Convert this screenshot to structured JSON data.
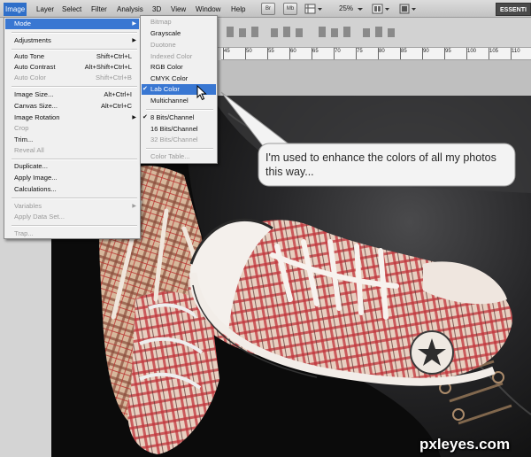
{
  "menubar": {
    "items": [
      "Image",
      "Layer",
      "Select",
      "Filter",
      "Analysis",
      "3D",
      "View",
      "Window",
      "Help"
    ],
    "tool_icons": [
      "Br",
      "Mb"
    ],
    "zoom": "25%",
    "workspace": "ESSENTI"
  },
  "ruler": {
    "numbers": [
      "45",
      "50",
      "55",
      "60",
      "65",
      "70",
      "75",
      "80",
      "85",
      "90",
      "95",
      "100",
      "105",
      "110"
    ]
  },
  "image_menu": {
    "items": [
      {
        "label": "Mode",
        "shortcut": "",
        "submenu": true,
        "state": "highlighted"
      },
      {
        "label": "Adjustments",
        "shortcut": "",
        "submenu": true,
        "state": "enabled"
      },
      {
        "label": "Auto Tone",
        "shortcut": "Shift+Ctrl+L",
        "submenu": false,
        "state": "enabled"
      },
      {
        "label": "Auto Contrast",
        "shortcut": "Alt+Shift+Ctrl+L",
        "submenu": false,
        "state": "enabled"
      },
      {
        "label": "Auto Color",
        "shortcut": "Shift+Ctrl+B",
        "submenu": false,
        "state": "disabled"
      },
      {
        "label": "Image Size...",
        "shortcut": "Alt+Ctrl+I",
        "submenu": false,
        "state": "enabled"
      },
      {
        "label": "Canvas Size...",
        "shortcut": "Alt+Ctrl+C",
        "submenu": false,
        "state": "enabled"
      },
      {
        "label": "Image Rotation",
        "shortcut": "",
        "submenu": true,
        "state": "enabled"
      },
      {
        "label": "Crop",
        "shortcut": "",
        "submenu": false,
        "state": "disabled"
      },
      {
        "label": "Trim...",
        "shortcut": "",
        "submenu": false,
        "state": "enabled"
      },
      {
        "label": "Reveal All",
        "shortcut": "",
        "submenu": false,
        "state": "disabled"
      },
      {
        "label": "Duplicate...",
        "shortcut": "",
        "submenu": false,
        "state": "enabled"
      },
      {
        "label": "Apply Image...",
        "shortcut": "",
        "submenu": false,
        "state": "enabled"
      },
      {
        "label": "Calculations...",
        "shortcut": "",
        "submenu": false,
        "state": "enabled"
      },
      {
        "label": "Variables",
        "shortcut": "",
        "submenu": true,
        "state": "disabled"
      },
      {
        "label": "Apply Data Set...",
        "shortcut": "",
        "submenu": false,
        "state": "disabled"
      },
      {
        "label": "Trap...",
        "shortcut": "",
        "submenu": false,
        "state": "disabled"
      }
    ]
  },
  "mode_submenu": {
    "items": [
      {
        "label": "Bitmap",
        "checked": false,
        "state": "disabled"
      },
      {
        "label": "Grayscale",
        "checked": false,
        "state": "enabled"
      },
      {
        "label": "Duotone",
        "checked": false,
        "state": "disabled"
      },
      {
        "label": "Indexed Color",
        "checked": false,
        "state": "disabled"
      },
      {
        "label": "RGB Color",
        "checked": false,
        "state": "enabled"
      },
      {
        "label": "CMYK Color",
        "checked": false,
        "state": "enabled"
      },
      {
        "label": "Lab Color",
        "checked": true,
        "state": "highlighted"
      },
      {
        "label": "Multichannel",
        "checked": false,
        "state": "enabled"
      },
      {
        "label": "8 Bits/Channel",
        "checked": true,
        "state": "enabled"
      },
      {
        "label": "16 Bits/Channel",
        "checked": false,
        "state": "enabled"
      },
      {
        "label": "32 Bits/Channel",
        "checked": false,
        "state": "disabled"
      },
      {
        "label": "Color Table...",
        "checked": false,
        "state": "disabled"
      }
    ]
  },
  "callout": {
    "text": "I'm used to enhance the colors of all my photos this way..."
  },
  "watermark": "pxleyes.com",
  "colors": {
    "menu_highlight": "#3977d2",
    "menubar_bg": "#c8c8c8",
    "callout_bg": "#f3f3f3"
  }
}
